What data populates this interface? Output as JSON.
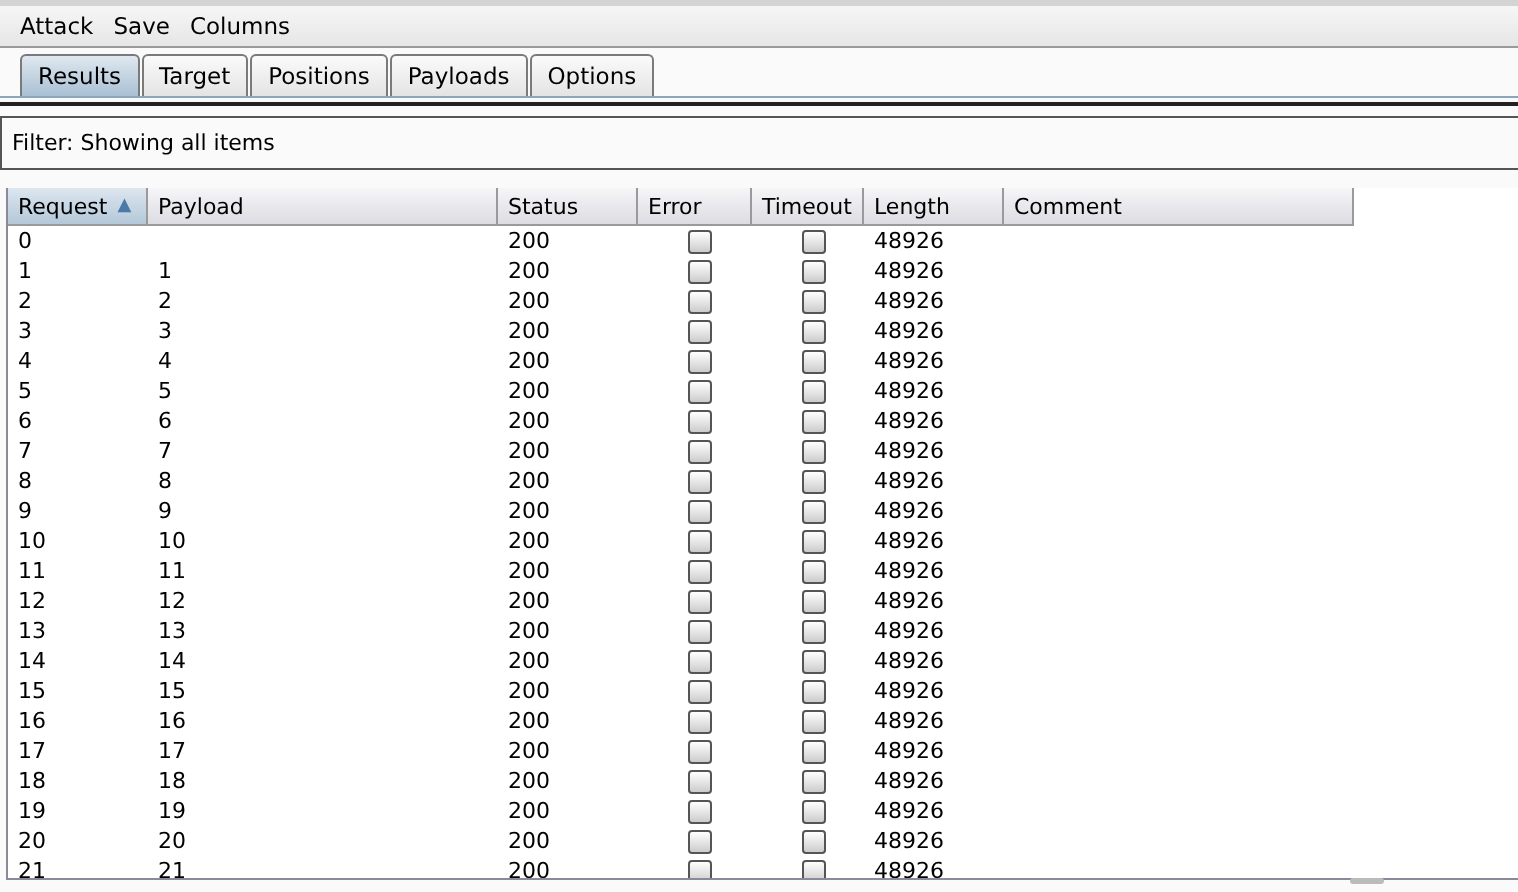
{
  "menu": [
    "Attack",
    "Save",
    "Columns"
  ],
  "tabs": [
    {
      "label": "Results",
      "selected": true
    },
    {
      "label": "Target",
      "selected": false
    },
    {
      "label": "Positions",
      "selected": false
    },
    {
      "label": "Payloads",
      "selected": false
    },
    {
      "label": "Options",
      "selected": false
    }
  ],
  "filter": "Filter:  Showing all items",
  "table": {
    "columns": [
      {
        "label": "Request",
        "sorted": true
      },
      {
        "label": "Payload",
        "sorted": false
      },
      {
        "label": "Status",
        "sorted": false
      },
      {
        "label": "Error",
        "sorted": false
      },
      {
        "label": "Timeout",
        "sorted": false
      },
      {
        "label": "Length",
        "sorted": false
      },
      {
        "label": "Comment",
        "sorted": false
      }
    ],
    "sort_glyph": "▲",
    "rows": [
      {
        "request": "0",
        "payload": "",
        "status": "200",
        "error": false,
        "timeout": false,
        "length": "48926"
      },
      {
        "request": "1",
        "payload": "1",
        "status": "200",
        "error": false,
        "timeout": false,
        "length": "48926"
      },
      {
        "request": "2",
        "payload": "2",
        "status": "200",
        "error": false,
        "timeout": false,
        "length": "48926"
      },
      {
        "request": "3",
        "payload": "3",
        "status": "200",
        "error": false,
        "timeout": false,
        "length": "48926"
      },
      {
        "request": "4",
        "payload": "4",
        "status": "200",
        "error": false,
        "timeout": false,
        "length": "48926"
      },
      {
        "request": "5",
        "payload": "5",
        "status": "200",
        "error": false,
        "timeout": false,
        "length": "48926"
      },
      {
        "request": "6",
        "payload": "6",
        "status": "200",
        "error": false,
        "timeout": false,
        "length": "48926"
      },
      {
        "request": "7",
        "payload": "7",
        "status": "200",
        "error": false,
        "timeout": false,
        "length": "48926"
      },
      {
        "request": "8",
        "payload": "8",
        "status": "200",
        "error": false,
        "timeout": false,
        "length": "48926"
      },
      {
        "request": "9",
        "payload": "9",
        "status": "200",
        "error": false,
        "timeout": false,
        "length": "48926"
      },
      {
        "request": "10",
        "payload": "10",
        "status": "200",
        "error": false,
        "timeout": false,
        "length": "48926"
      },
      {
        "request": "11",
        "payload": "11",
        "status": "200",
        "error": false,
        "timeout": false,
        "length": "48926"
      },
      {
        "request": "12",
        "payload": "12",
        "status": "200",
        "error": false,
        "timeout": false,
        "length": "48926"
      },
      {
        "request": "13",
        "payload": "13",
        "status": "200",
        "error": false,
        "timeout": false,
        "length": "48926"
      },
      {
        "request": "14",
        "payload": "14",
        "status": "200",
        "error": false,
        "timeout": false,
        "length": "48926"
      },
      {
        "request": "15",
        "payload": "15",
        "status": "200",
        "error": false,
        "timeout": false,
        "length": "48926"
      },
      {
        "request": "16",
        "payload": "16",
        "status": "200",
        "error": false,
        "timeout": false,
        "length": "48926"
      },
      {
        "request": "17",
        "payload": "17",
        "status": "200",
        "error": false,
        "timeout": false,
        "length": "48926"
      },
      {
        "request": "18",
        "payload": "18",
        "status": "200",
        "error": false,
        "timeout": false,
        "length": "48926"
      },
      {
        "request": "19",
        "payload": "19",
        "status": "200",
        "error": false,
        "timeout": false,
        "length": "48926"
      },
      {
        "request": "20",
        "payload": "20",
        "status": "200",
        "error": false,
        "timeout": false,
        "length": "48926"
      },
      {
        "request": "21",
        "payload": "21",
        "status": "200",
        "error": false,
        "timeout": false,
        "length": "48926"
      }
    ]
  }
}
